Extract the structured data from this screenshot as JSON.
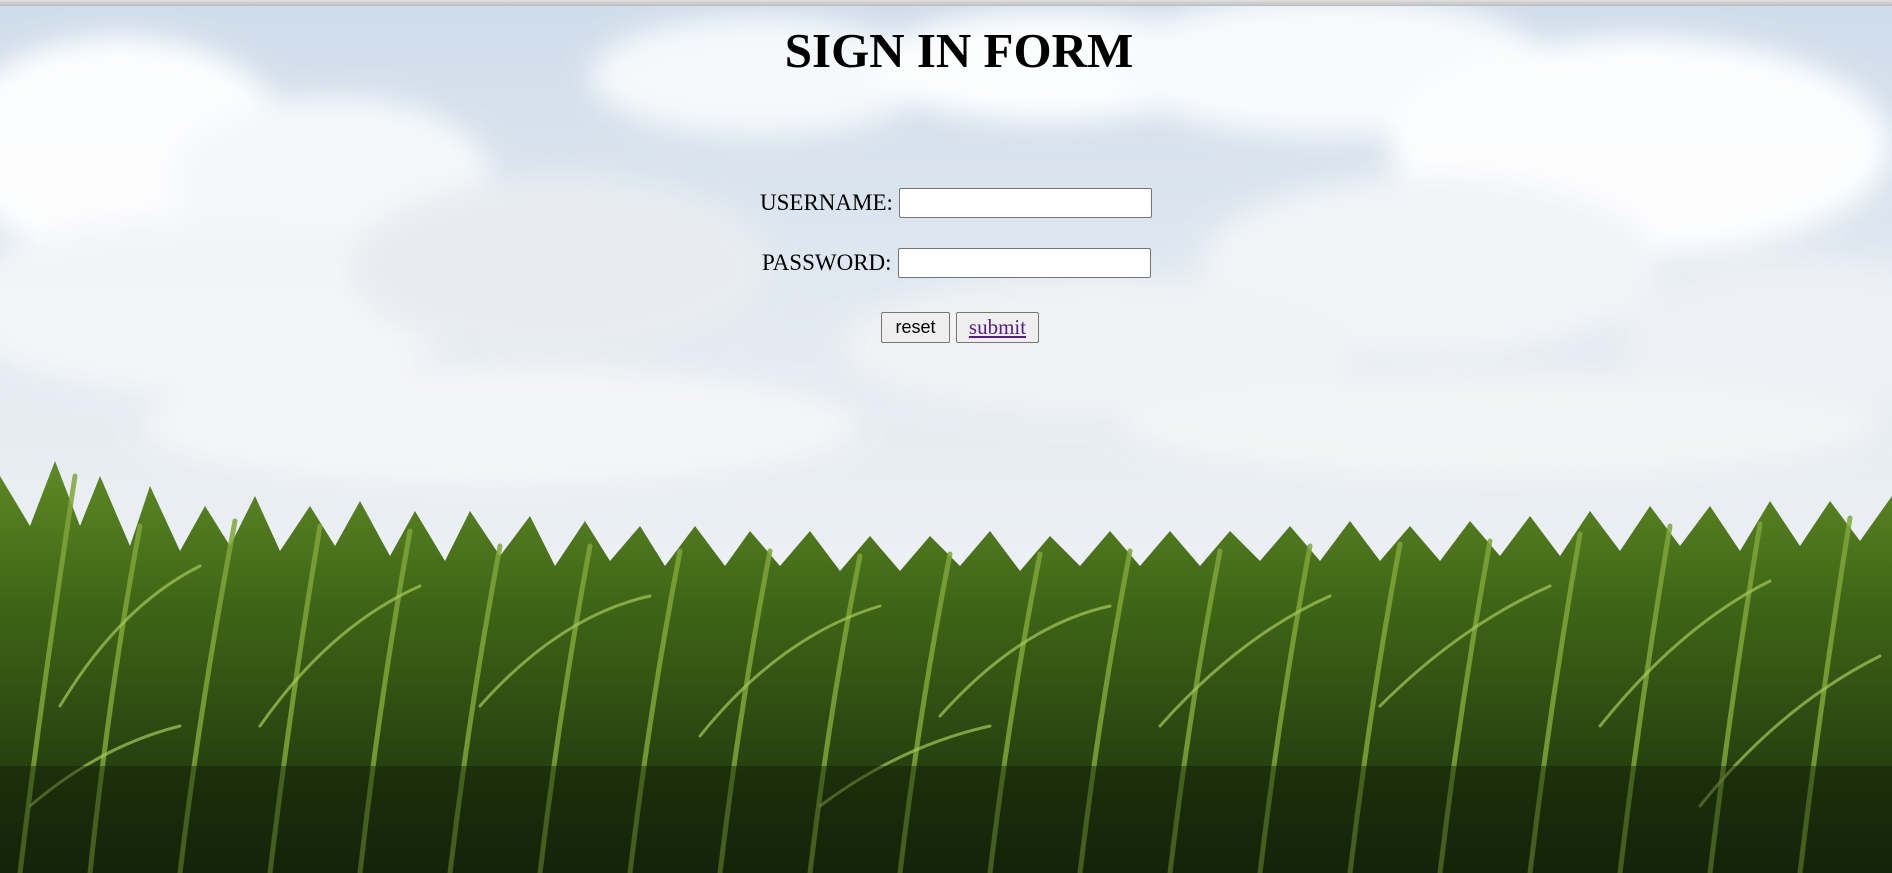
{
  "page": {
    "title": "SIGN IN FORM"
  },
  "form": {
    "username_label": "USERNAME:",
    "username_value": "",
    "password_label": "PASSWORD:",
    "password_value": "",
    "reset_label": "reset",
    "submit_label": "submit"
  },
  "colors": {
    "sky": "#e4ebf3",
    "corn_dark": "#23400f",
    "corn_light": "#6f9a2a",
    "visited_link": "#551a8b"
  }
}
